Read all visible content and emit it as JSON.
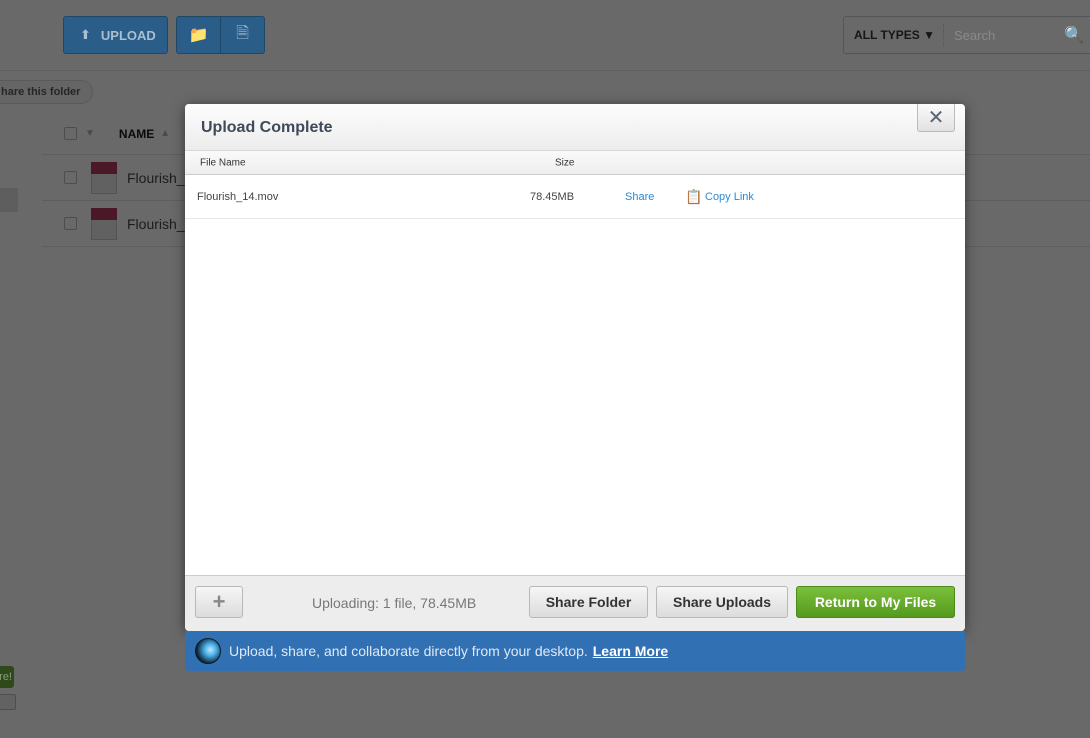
{
  "toolbar": {
    "upload_label": "UPLOAD",
    "type_filter": "ALL TYPES",
    "search_placeholder": "Search"
  },
  "folder": {
    "share_label": "hare this folder"
  },
  "list": {
    "name_header": "NAME",
    "rows": [
      {
        "name": "Flourish_"
      },
      {
        "name": "Flourish_"
      }
    ]
  },
  "side": {
    "green_text": "re!"
  },
  "modal": {
    "title": "Upload Complete",
    "columns": {
      "file_name": "File Name",
      "size": "Size"
    },
    "files": [
      {
        "name": "Flourish_14.mov",
        "size": "78.45MB",
        "share": "Share",
        "copy_link": "Copy Link"
      }
    ],
    "status": "Uploading: 1 file, 78.45MB",
    "share_folder": "Share Folder",
    "share_uploads": "Share Uploads",
    "return": "Return to My Files"
  },
  "banner": {
    "text": "Upload, share, and collaborate directly from your desktop.",
    "link": "Learn More"
  },
  "colors": {
    "primary": "#3b8fd6",
    "green": "#6aae2f",
    "banner": "#3270b4"
  }
}
